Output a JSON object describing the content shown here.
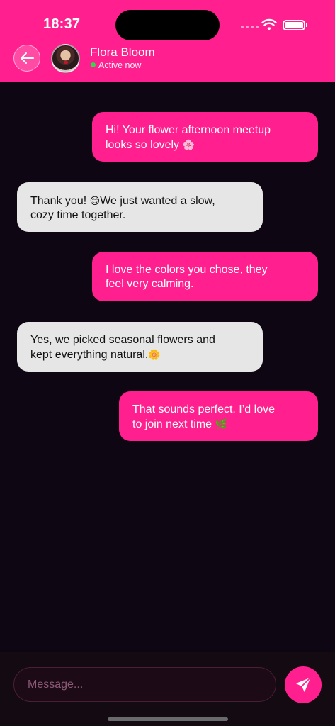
{
  "status_bar": {
    "time": "18:37"
  },
  "header": {
    "contact_name": "Flora Bloom",
    "contact_status": "Active now"
  },
  "messages": [
    {
      "side": "sent",
      "line1": "Hi! Your flower afternoon meetup",
      "line2": "looks so lovely",
      "emoji": "🌸"
    },
    {
      "side": "received",
      "line1_pre": "Thank you! ",
      "line1_emoji": "😊",
      "line1_post": "We just wanted a slow,",
      "line2": "cozy time together."
    },
    {
      "side": "sent",
      "line1": "I love the colors you chose, they",
      "line2": "feel very calming."
    },
    {
      "side": "received",
      "line1": "Yes, we picked seasonal flowers and",
      "line2": "kept everything natural.",
      "emoji": "🌼"
    },
    {
      "side": "sent",
      "line1": "That sounds perfect. I’d love",
      "line2": "to join next time",
      "emoji": "🌿"
    }
  ],
  "composer": {
    "placeholder": "Message..."
  },
  "colors": {
    "accent": "#ff1f8e",
    "background": "#0e0612",
    "received_bubble": "#e6e6e6",
    "online": "#32d74b"
  },
  "icons": {
    "back": "arrow-left-icon",
    "send": "paper-plane-icon",
    "wifi": "wifi-icon",
    "battery": "battery-icon"
  }
}
